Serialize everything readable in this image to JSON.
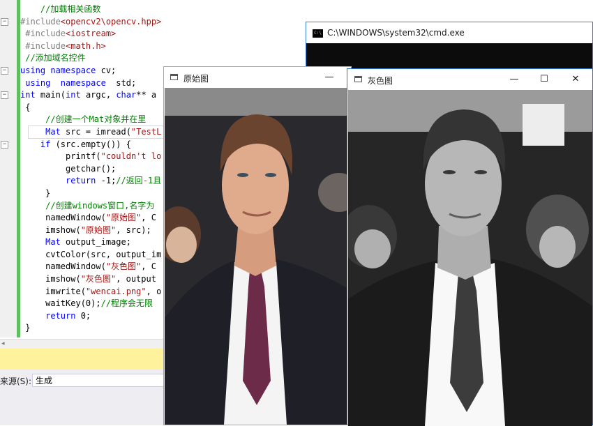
{
  "editor": {
    "lines": [
      {
        "fold": "",
        "parts": [
          {
            "c": "cm",
            "t": "    //加载相关函数"
          }
        ]
      },
      {
        "fold": "⊟",
        "parts": [
          {
            "c": "pp",
            "t": "#include"
          },
          {
            "c": "inc",
            "t": "<opencv2\\opencv.hpp>"
          }
        ]
      },
      {
        "fold": "",
        "parts": [
          {
            "c": "pp",
            "t": " #include"
          },
          {
            "c": "inc",
            "t": "<iostream>"
          }
        ]
      },
      {
        "fold": "",
        "parts": [
          {
            "c": "pp",
            "t": " #include"
          },
          {
            "c": "inc",
            "t": "<math.h>"
          }
        ]
      },
      {
        "fold": "",
        "parts": [
          {
            "c": "cm",
            "t": " //添加域名控件"
          }
        ]
      },
      {
        "fold": "⊟",
        "parts": [
          {
            "c": "kw",
            "t": "using namespace"
          },
          {
            "c": "tx",
            "t": " cv;"
          }
        ]
      },
      {
        "fold": "",
        "parts": [
          {
            "c": "kw",
            "t": " using  namespace"
          },
          {
            "c": "tx",
            "t": "  std;"
          }
        ]
      },
      {
        "fold": "⊟",
        "parts": [
          {
            "c": "kw",
            "t": "int"
          },
          {
            "c": "tx",
            "t": " main("
          },
          {
            "c": "kw",
            "t": "int"
          },
          {
            "c": "tx",
            "t": " argc, "
          },
          {
            "c": "kw",
            "t": "char"
          },
          {
            "c": "tx",
            "t": "** a"
          }
        ]
      },
      {
        "fold": "",
        "parts": [
          {
            "c": "tx",
            "t": " {"
          }
        ]
      },
      {
        "fold": "",
        "parts": [
          {
            "c": "cm",
            "t": "     //创建一个Mat对象并在里"
          }
        ]
      },
      {
        "fold": "",
        "parts": [
          {
            "c": "tx",
            "t": "     "
          },
          {
            "c": "kw",
            "t": "Mat"
          },
          {
            "c": "tx",
            "t": " src = imread("
          },
          {
            "c": "str",
            "t": "\"TestL"
          }
        ]
      },
      {
        "fold": "⊟",
        "parts": [
          {
            "c": "tx",
            "t": "    "
          },
          {
            "c": "kw",
            "t": "if"
          },
          {
            "c": "tx",
            "t": " (src.empty()) {"
          }
        ]
      },
      {
        "fold": "",
        "parts": [
          {
            "c": "tx",
            "t": "         printf("
          },
          {
            "c": "str",
            "t": "\"couldn't lo"
          }
        ]
      },
      {
        "fold": "",
        "parts": [
          {
            "c": "tx",
            "t": "         getchar();"
          }
        ]
      },
      {
        "fold": "",
        "parts": [
          {
            "c": "tx",
            "t": "         "
          },
          {
            "c": "kw",
            "t": "return"
          },
          {
            "c": "tx",
            "t": " -1;"
          },
          {
            "c": "cm",
            "t": "//返回-1且"
          }
        ]
      },
      {
        "fold": "",
        "parts": [
          {
            "c": "tx",
            "t": "     }"
          }
        ]
      },
      {
        "fold": "",
        "parts": [
          {
            "c": "cm",
            "t": "     //创建windows窗口,名字为"
          }
        ]
      },
      {
        "fold": "",
        "parts": [
          {
            "c": "tx",
            "t": "     namedWindow("
          },
          {
            "c": "str",
            "t": "\"原始图\""
          },
          {
            "c": "tx",
            "t": ", C"
          }
        ]
      },
      {
        "fold": "",
        "parts": [
          {
            "c": "tx",
            "t": "     imshow("
          },
          {
            "c": "str",
            "t": "\"原始图\""
          },
          {
            "c": "tx",
            "t": ", src);"
          }
        ]
      },
      {
        "fold": "",
        "parts": [
          {
            "c": "tx",
            "t": "     "
          },
          {
            "c": "kw",
            "t": "Mat"
          },
          {
            "c": "tx",
            "t": " output_image;"
          }
        ]
      },
      {
        "fold": "",
        "parts": [
          {
            "c": "tx",
            "t": "     cvtColor(src, output_im"
          }
        ]
      },
      {
        "fold": "",
        "parts": [
          {
            "c": "tx",
            "t": "     namedWindow("
          },
          {
            "c": "str",
            "t": "\"灰色图\""
          },
          {
            "c": "tx",
            "t": ", C"
          }
        ]
      },
      {
        "fold": "",
        "parts": [
          {
            "c": "tx",
            "t": "     imshow("
          },
          {
            "c": "str",
            "t": "\"灰色图\""
          },
          {
            "c": "tx",
            "t": ", output"
          }
        ]
      },
      {
        "fold": "",
        "parts": [
          {
            "c": "tx",
            "t": "     imwrite("
          },
          {
            "c": "str",
            "t": "\"wencai.png\""
          },
          {
            "c": "tx",
            "t": ", o"
          }
        ]
      },
      {
        "fold": "",
        "parts": [
          {
            "c": "tx",
            "t": "     waitKey(0);"
          },
          {
            "c": "cm",
            "t": "//程序会无限"
          }
        ]
      },
      {
        "fold": "",
        "parts": [
          {
            "c": "tx",
            "t": "     "
          },
          {
            "c": "kw",
            "t": "return"
          },
          {
            "c": "tx",
            "t": " 0;"
          }
        ]
      },
      {
        "fold": "",
        "parts": [
          {
            "c": "tx",
            "t": " }"
          }
        ]
      }
    ]
  },
  "output": {
    "source_label": "来源(S):",
    "source_value": "生成"
  },
  "cmd_window": {
    "title": "C:\\WINDOWS\\system32\\cmd.exe",
    "icon": "cmd-icon"
  },
  "original_window": {
    "title": "原始图",
    "minimize": "—"
  },
  "gray_window": {
    "title": "灰色图",
    "minimize": "—",
    "maximize": "☐",
    "close": "✕"
  },
  "colors": {
    "change_bar": "#5fbf5f",
    "yellow_bar": "#fff29d",
    "cmd_bg": "#0c0c0c",
    "active_border": "#2b73d6"
  }
}
